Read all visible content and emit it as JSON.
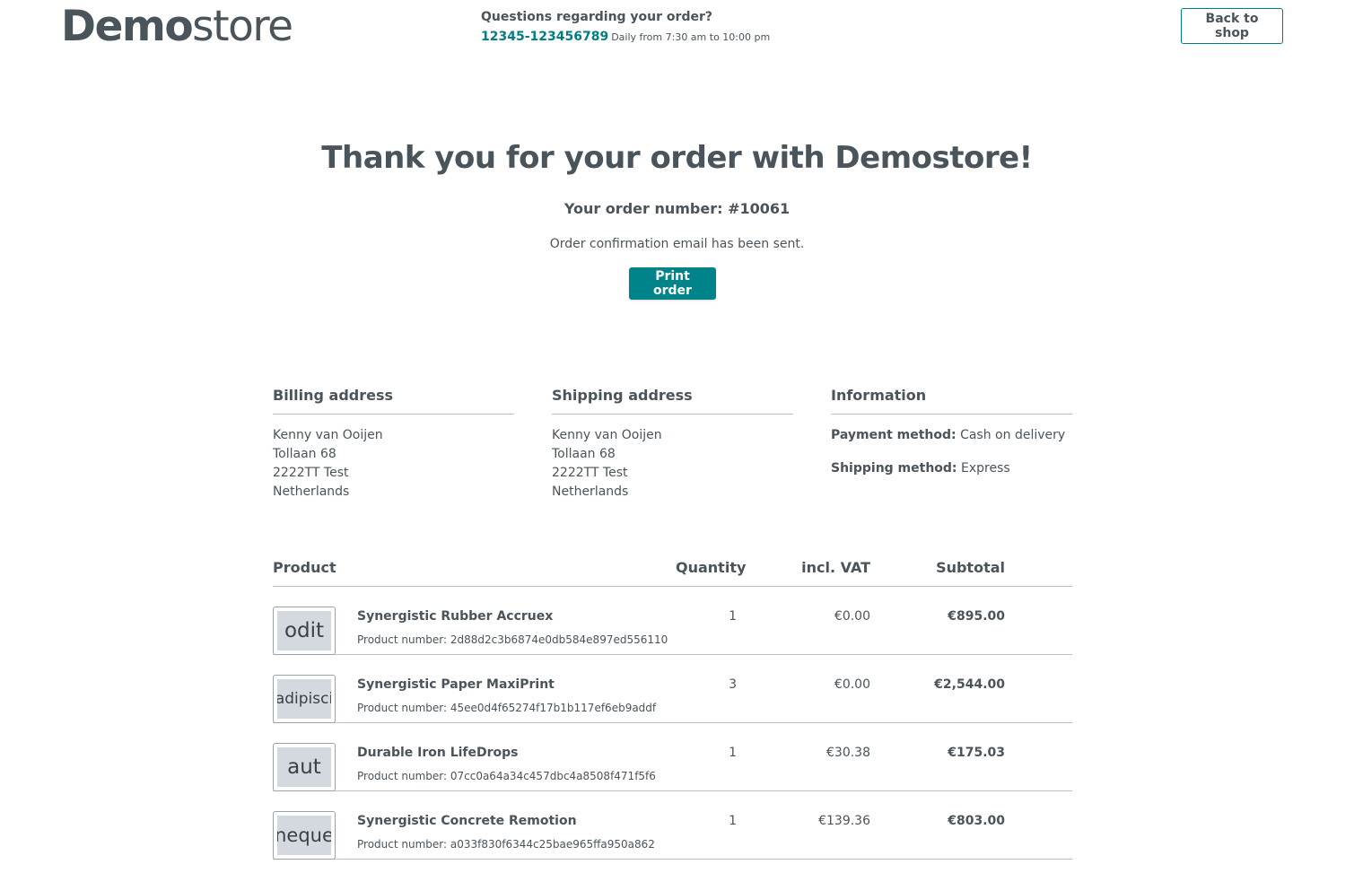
{
  "header": {
    "logo_bold": "Demo",
    "logo_light": "store",
    "contact_question": "Questions regarding your order?",
    "contact_phone": "12345-123456789",
    "contact_hours": "Daily from 7:30 am to 10:00 pm",
    "back_button": "Back to shop"
  },
  "confirmation": {
    "title": "Thank you for your order with Demostore!",
    "order_number": "Your order number: #10061",
    "email_message": "Order confirmation email has been sent.",
    "print_button": "Print order"
  },
  "billing": {
    "title": "Billing address",
    "lines": [
      "Kenny van Ooijen",
      "Tollaan 68",
      "2222TT Test",
      "Netherlands"
    ]
  },
  "shipping": {
    "title": "Shipping address",
    "lines": [
      "Kenny van Ooijen",
      "Tollaan 68",
      "2222TT Test",
      "Netherlands"
    ]
  },
  "information": {
    "title": "Information",
    "payment_label": "Payment method:",
    "payment_value": "Cash on delivery",
    "shipping_label": "Shipping method:",
    "shipping_value": "Express"
  },
  "table": {
    "headers": {
      "product": "Product",
      "quantity": "Quantity",
      "vat": "incl. VAT",
      "subtotal": "Subtotal"
    },
    "rows": [
      {
        "thumb": "odit",
        "name": "Synergistic Rubber Accruex",
        "product_number": "Product number: 2d88d2c3b6874e0db584e897ed556110",
        "quantity": "1",
        "vat": "€0.00",
        "subtotal": "€895.00"
      },
      {
        "thumb": "adipisci",
        "name": "Synergistic Paper MaxiPrint",
        "product_number": "Product number: 45ee0d4f65274f17b1b117ef6eb9addf",
        "quantity": "3",
        "vat": "€0.00",
        "subtotal": "€2,544.00"
      },
      {
        "thumb": "aut",
        "name": "Durable Iron LifeDrops",
        "product_number": "Product number: 07cc0a64a34c457dbc4a8508f471f5f6",
        "quantity": "1",
        "vat": "€30.38",
        "subtotal": "€175.03"
      },
      {
        "thumb": "neque",
        "name": "Synergistic Concrete Remotion",
        "product_number": "Product number: a033f830f6344c25bae965ffa950a862",
        "quantity": "1",
        "vat": "€139.36",
        "subtotal": "€803.00"
      }
    ]
  },
  "colors": {
    "accent": "#008489",
    "text": "#4a545b",
    "divider": "#bcc1c7"
  }
}
